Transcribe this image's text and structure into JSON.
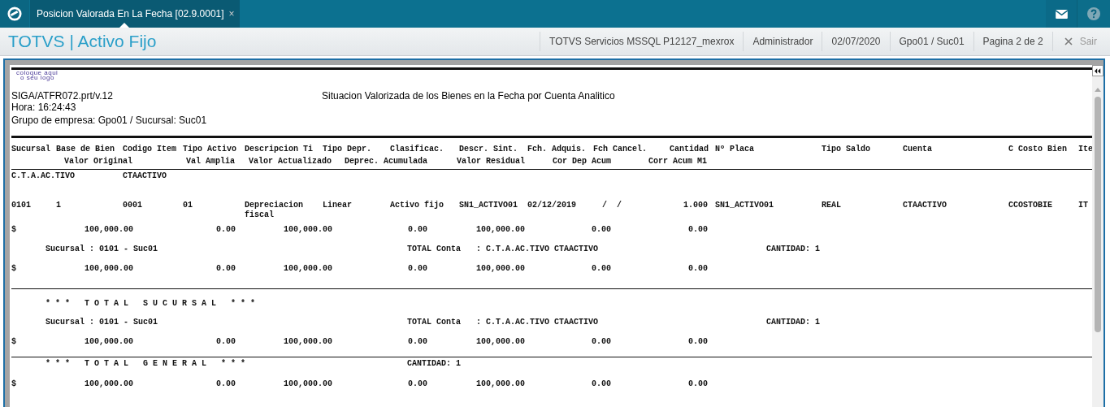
{
  "tab": {
    "title": "Posicion Valorada En La Fecha [02.9.0001]",
    "close": "×"
  },
  "header": {
    "app_title": "TOTVS | Activo Fijo",
    "info_items": [
      "TOTVS Servicios MSSQL P12127_mexrox",
      "Administrador",
      "02/07/2020",
      "Gpo01 / Suc01",
      "Pagina 2 de 2"
    ],
    "exit_button": "Sair"
  },
  "report": {
    "logo_text": [
      "coloque aqui",
      "o seu logo"
    ],
    "info_lines": [
      "SIGA/ATFR072.prt/v.12",
      "Hora: 16:24:43",
      "Grupo de empresa: Gpo01 / Sucursal: Suc01"
    ],
    "title": "Situacion Valorizada de los Bienes en la Fecha por  Cuenta Analitico",
    "lines": [
      {
        "kind": "header1",
        "texts": [
          "Sucursal",
          "Base de Bien",
          "Codigo Item",
          "Tipo Activo",
          "Descripcion Ti",
          "Tipo Depr.",
          "Clasificac.",
          "Descr. Sint.",
          "Fch. Adquis.",
          "Fch Cancel.",
          "Cantidad",
          "Nº Placa",
          "Tipo Saldo",
          "Cuenta",
          "C Costo Bien",
          "Ite"
        ]
      },
      {
        "kind": "header2",
        "texts": [
          "Valor Original",
          "Val Amplia",
          "Valor Actualizado",
          "Deprec. Acumulada",
          "Valor Residual",
          "Cor Dep Acum",
          "Corr Acum M1"
        ]
      },
      {
        "kind": "account",
        "texts": [
          "C.T.A.AC.TIVO",
          "CTAACTIVO"
        ]
      },
      {
        "kind": "item",
        "texts": [
          "0101",
          "1",
          "0001",
          "01",
          "Depreciacion fiscal",
          "Linear",
          "Activo fijo",
          "SN1_ACTIVO01",
          "02/12/2019",
          "/  /",
          "1.000",
          "SN1_ACTIVO01",
          "REAL",
          "CTAACTIVO",
          "CCOSTOBIE",
          "IT"
        ]
      },
      {
        "kind": "amounts",
        "texts": [
          "$",
          "100,000.00",
          "0.00",
          "100,000.00",
          "0.00",
          "100,000.00",
          "0.00",
          "0.00"
        ]
      },
      {
        "kind": "subtotal",
        "texts": [
          "Sucursal : 0101 - Suc01",
          "TOTAL Conta",
          ": C.T.A.AC.TIVO CTAACTIVO",
          "CANTIDAD: 1"
        ]
      },
      {
        "kind": "amounts",
        "texts": [
          "$",
          "100,000.00",
          "0.00",
          "100,000.00",
          "0.00",
          "100,000.00",
          "0.00",
          "0.00"
        ]
      },
      {
        "kind": "banner",
        "texts": [
          "* * *   T O T A L   S U C U R S A L   * * *"
        ]
      },
      {
        "kind": "subtotal",
        "texts": [
          "Sucursal : 0101 - Suc01",
          "TOTAL Conta",
          ": C.T.A.AC.TIVO CTAACTIVO",
          "CANTIDAD: 1"
        ]
      },
      {
        "kind": "amounts",
        "texts": [
          "$",
          "100,000.00",
          "0.00",
          "100,000.00",
          "0.00",
          "100,000.00",
          "0.00",
          "0.00"
        ]
      },
      {
        "kind": "general",
        "texts": [
          "* * *   T O T A L   G E N E R A L   * * *",
          "CANTIDAD: 1"
        ]
      },
      {
        "kind": "amounts",
        "texts": [
          "$",
          "100,000.00",
          "0.00",
          "100,000.00",
          "0.00",
          "100,000.00",
          "0.00",
          "0.00"
        ]
      }
    ]
  }
}
